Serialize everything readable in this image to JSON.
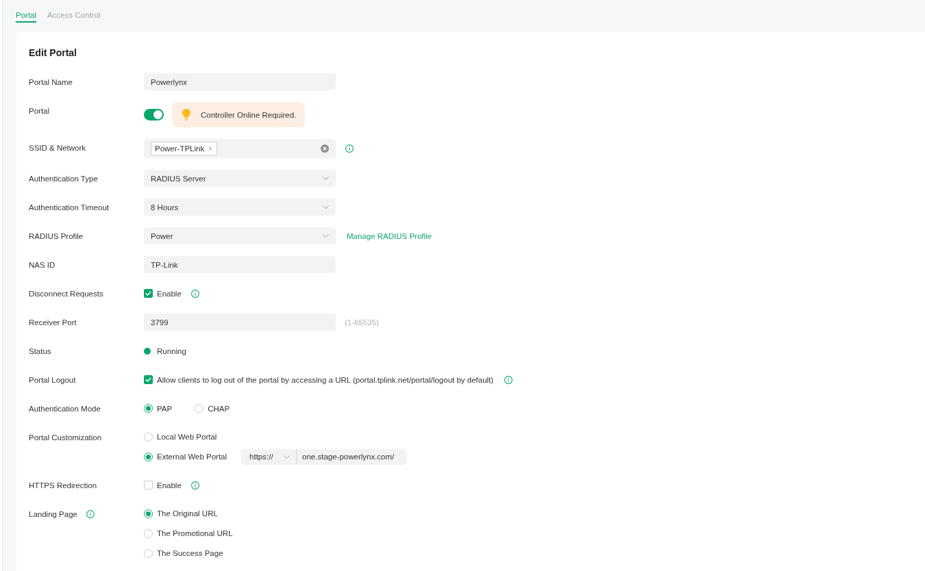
{
  "tabs": [
    {
      "label": "Portal",
      "selected": true
    },
    {
      "label": "Access Control",
      "selected": false
    }
  ],
  "form": {
    "title": "Edit Portal",
    "fields": [
      {
        "kind": "input",
        "label": "Portal Name",
        "value": "Powerlynx"
      },
      {
        "kind": "toggle",
        "label": "Portal",
        "on": true,
        "notice": "Controller Online Required."
      },
      {
        "kind": "tags",
        "label": "SSID & Network",
        "tags": [
          "Power-TPLink"
        ],
        "info": true
      },
      {
        "kind": "select",
        "label": "Authentication Type",
        "value": "RADIUS Server"
      },
      {
        "kind": "select",
        "label": "Authentication Timeout",
        "value": "8 Hours"
      },
      {
        "kind": "select",
        "label": "RADIUS Profile",
        "value": "Power",
        "link": "Manage RADIUS Profile"
      },
      {
        "kind": "input",
        "label": "NAS ID",
        "value": "TP-Link"
      },
      {
        "kind": "checkbox",
        "label": "Disconnect Requests",
        "text": "Enable",
        "checked": true,
        "info": true
      },
      {
        "kind": "input",
        "label": "Receiver Port",
        "value": "3799",
        "hint": "(1-65535)"
      },
      {
        "kind": "status",
        "label": "Status",
        "value": "Running"
      },
      {
        "kind": "checkbox",
        "label": "Portal Logout",
        "text": "Allow clients to log out of the portal by accessing a URL (portal.tplink.net/portal/logout by default)",
        "checked": true,
        "info": true
      },
      {
        "kind": "radio-row",
        "label": "Authentication Mode",
        "options": [
          {
            "label": "PAP",
            "selected": true
          },
          {
            "label": "CHAP",
            "selected": false
          }
        ]
      },
      {
        "kind": "radio-list",
        "label": "Portal Customization",
        "options": [
          {
            "label": "Local Web Portal",
            "selected": false
          },
          {
            "label": "External Web Portal",
            "selected": true,
            "scheme": "https://",
            "url": "one.stage-powerlynx.com/"
          }
        ]
      },
      {
        "kind": "checkbox",
        "label": "HTTPS Redirection",
        "text": "Enable",
        "checked": false,
        "info": true
      },
      {
        "kind": "radio-list",
        "label": "Landing Page",
        "label_info": true,
        "options": [
          {
            "label": "The Original URL",
            "selected": true
          },
          {
            "label": "The Promotional URL",
            "selected": false
          },
          {
            "label": "The Success Page",
            "selected": false
          }
        ]
      }
    ]
  }
}
